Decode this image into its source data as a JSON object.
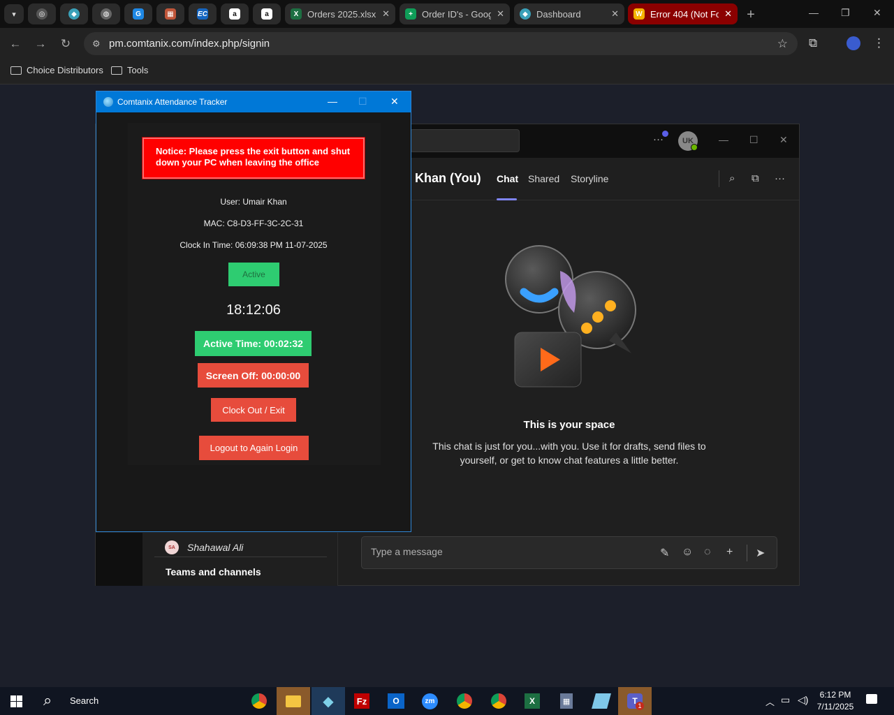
{
  "browser": {
    "tabs": [
      {
        "label": "Orders 2025.xlsx",
        "icon": "excel-icon",
        "color": "#1d6f42"
      },
      {
        "label": "Order ID's - Goog",
        "icon": "sheets-icon",
        "color": "#0f9d58"
      },
      {
        "label": "Dashboard",
        "icon": "dashboard-icon",
        "color": "#3aa0b8"
      },
      {
        "label": "Error 404 (Not Fo",
        "icon": "error-page-icon",
        "color": "#f4b400"
      }
    ],
    "pinned": [
      "EC",
      "a",
      "a"
    ],
    "url": "pm.comtanix.com/index.php/signin",
    "bookmarks": [
      "Choice Distributors",
      "Tools"
    ]
  },
  "tracker": {
    "title": "Comtanix Attendance Tracker",
    "notice": "Notice: Please press the exit button and shut down your PC when leaving the office",
    "user": "User: Umair Khan",
    "mac": "MAC: C8-D3-FF-3C-2C-31",
    "clock_in": "Clock In Time: 06:09:38 PM 11-07-2025",
    "status": "Active",
    "clock": "18:12:06",
    "active_time": "Active Time: 00:02:32",
    "screen_off": "Screen Off: 00:00:00",
    "clock_out": "Clock Out / Exit",
    "logout": "Logout to Again Login",
    "colors": {
      "notice": "#ff0000",
      "active": "#2ecc71",
      "danger": "#e74c3c",
      "titlebar": "#0078d7"
    }
  },
  "teams": {
    "avatar_initials": "UK",
    "chat_name": "ir Khan (You)",
    "tabs": [
      "Chat",
      "Shared",
      "Storyline"
    ],
    "space_title": "This is your space",
    "space_desc": "This chat is just for you...with you. Use it for drafts, send files to yourself, or get to know chat features a little better.",
    "contact_initials": "SA",
    "contact": "Shahawal Ali",
    "section": "Teams and channels",
    "compose_placeholder": "Type a message",
    "accent": "#7f85f5"
  },
  "taskbar": {
    "search": "Search",
    "time": "6:12 PM",
    "date": "7/11/2025",
    "teams_badge": "1"
  }
}
